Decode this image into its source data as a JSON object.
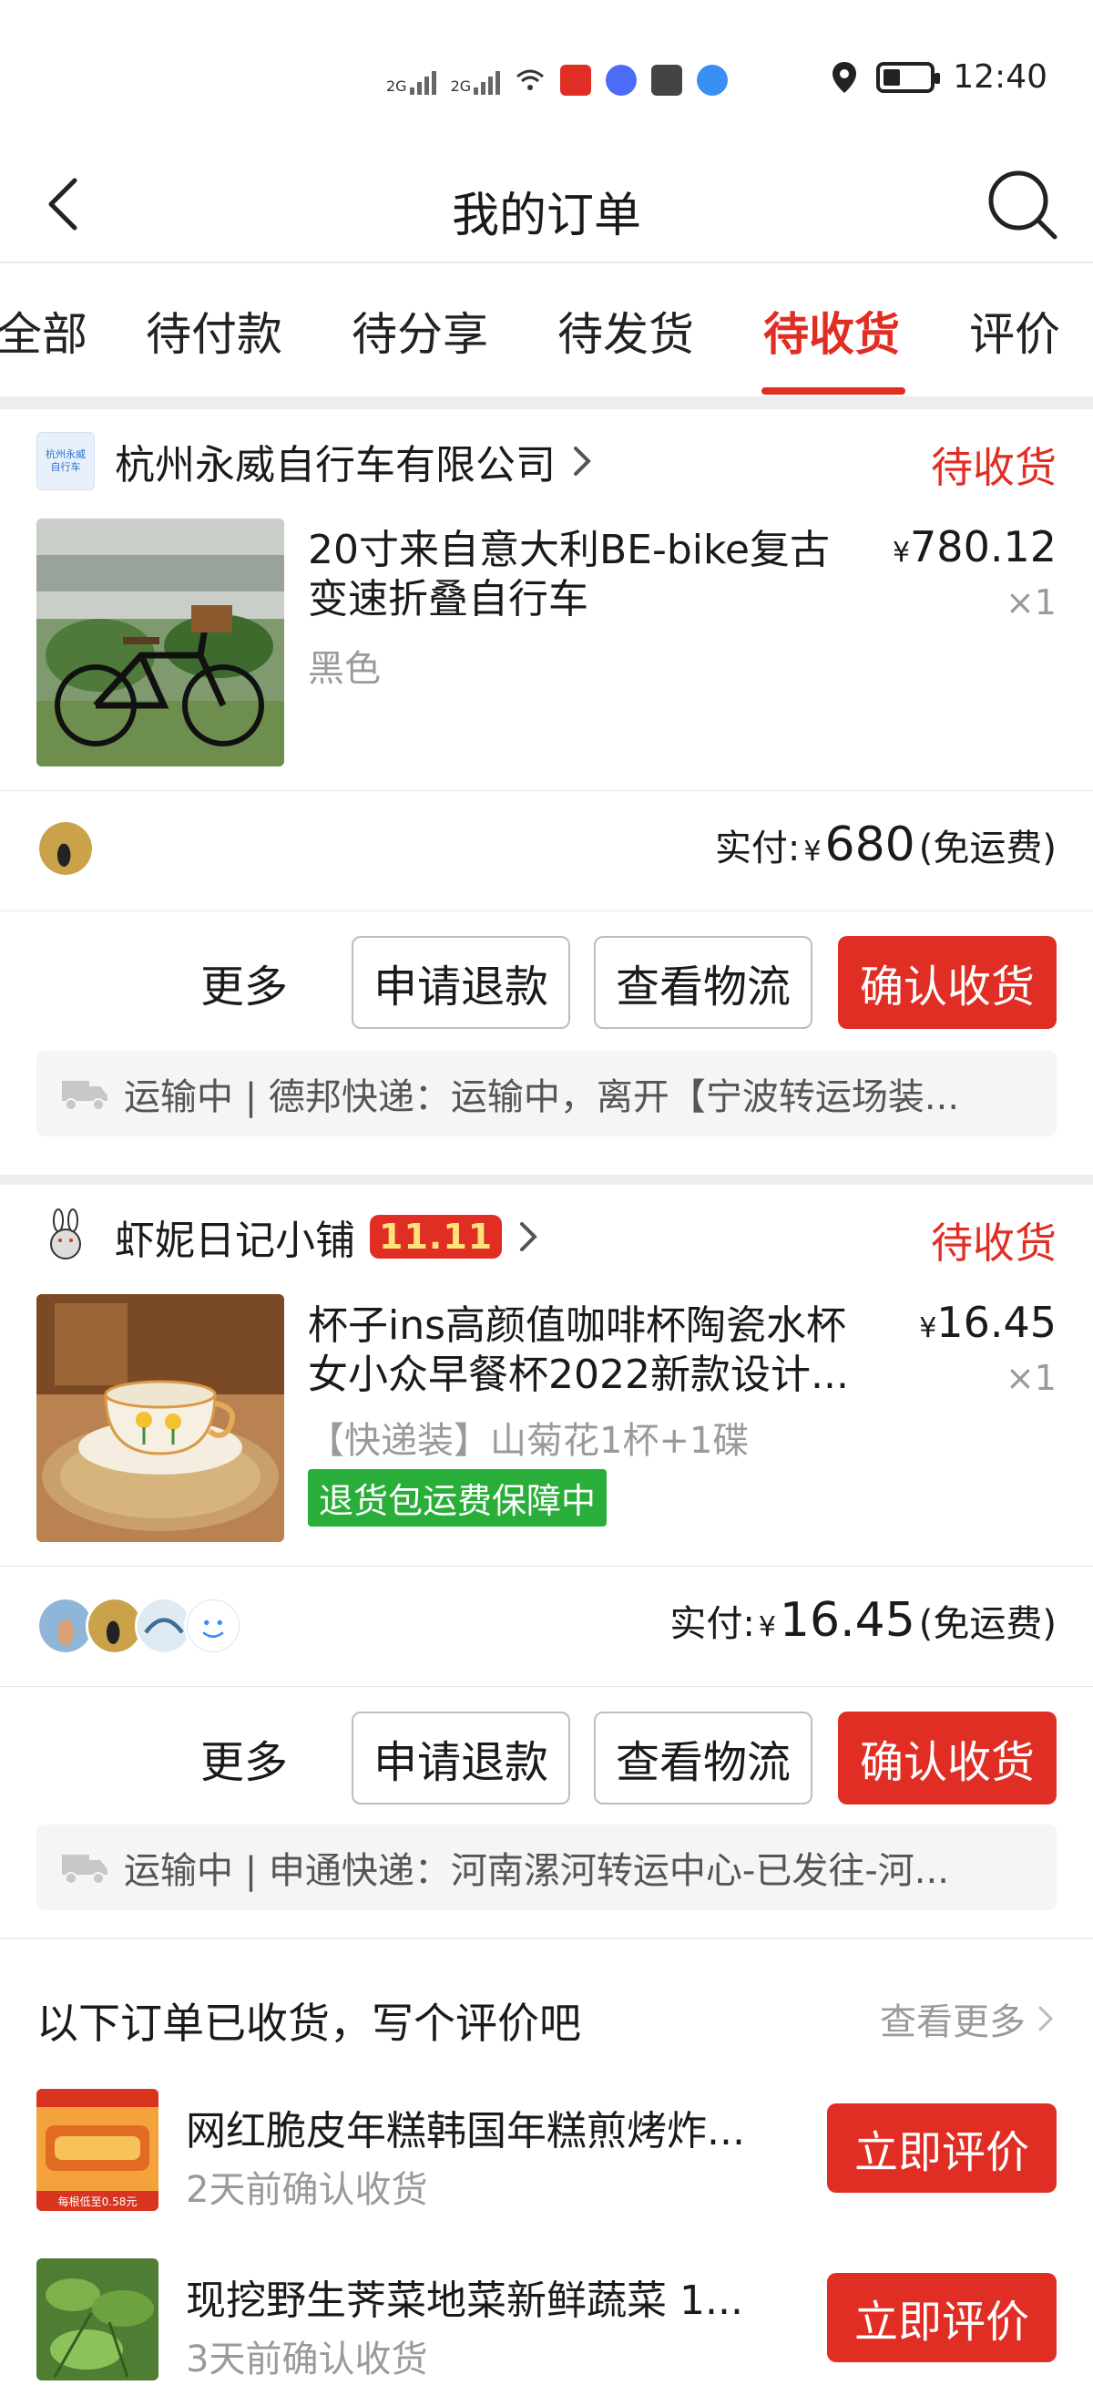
{
  "status_bar": {
    "signal1": "2G",
    "signal2": "2G",
    "time": "12:40"
  },
  "header": {
    "title": "我的订单"
  },
  "tabs": [
    {
      "label": "全部"
    },
    {
      "label": "待付款"
    },
    {
      "label": "待分享"
    },
    {
      "label": "待发货"
    },
    {
      "label": "待收货",
      "active": true
    },
    {
      "label": "评价"
    }
  ],
  "orders": [
    {
      "shop_name": "杭州永威自行车有限公司",
      "shop_logo_text": "杭州永威自行车",
      "status": "待收货",
      "product_title": "20寸来自意大利BE-bike复古变速折叠自行车",
      "variant": "黑色",
      "currency": "¥",
      "price": "780.12",
      "qty": "×1",
      "paid_label": "实付:",
      "paid_amount": "680",
      "shipping_note": "(免运费)",
      "more": "更多",
      "btn_refund": "申请退款",
      "btn_logistics": "查看物流",
      "btn_confirm": "确认收货",
      "logistics": "运输中 | 德邦快递：运输中，离开【宁波转运场装..."
    },
    {
      "shop_name": "虾妮日记小铺",
      "badge": "11.11",
      "status": "待收货",
      "product_title": "杯子ins高颜值咖啡杯陶瓷水杯女小众早餐杯2022新款设计...",
      "variant": "【快递装】山菊花1杯+1碟",
      "tag": "退货包运费保障中",
      "currency": "¥",
      "price": "16.45",
      "qty": "×1",
      "paid_label": "实付:",
      "paid_amount": "16.45",
      "shipping_note": "(免运费)",
      "more": "更多",
      "btn_refund": "申请退款",
      "btn_logistics": "查看物流",
      "btn_confirm": "确认收货",
      "logistics": "运输中 | 申通快递：河南漯河转运中心-已发往-河..."
    }
  ],
  "received": {
    "title": "以下订单已收货，写个评价吧",
    "view_more": "查看更多",
    "items": [
      {
        "name": "网红脆皮年糕韩国年糕煎烤炸...",
        "date": "2天前确认收货",
        "button": "立即评价",
        "thumb_caption": "每根低至0.58元"
      },
      {
        "name": "现挖野生荠菜地菜新鲜蔬菜 1...",
        "date": "3天前确认收货",
        "button": "立即评价"
      }
    ]
  },
  "colors": {
    "accent": "#e02e24",
    "green_tag": "#2aae3a",
    "muted": "#9a9a9a"
  }
}
